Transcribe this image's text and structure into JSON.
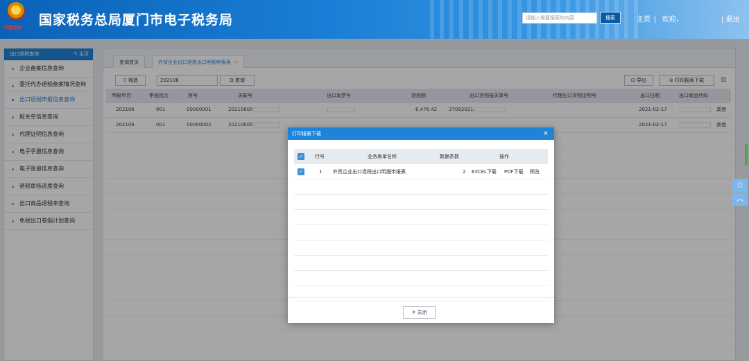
{
  "header": {
    "site_title": "国家税务总局厦门市电子税务局",
    "logo_text": "中国税务",
    "search_placeholder": "请输入需要搜索的内容",
    "search_button": "搜索",
    "nav_home": "主页",
    "nav_sep": "|",
    "nav_welcome": "欢迎，",
    "logout": "| 退出"
  },
  "sidebar": {
    "title": "出口退税查询",
    "home": "↰ 主页",
    "items": [
      {
        "label": "企业备案信息查询"
      },
      {
        "label": "委托代办退税备案情况查询"
      },
      {
        "label": "出口退税申报信息查询"
      },
      {
        "label": "报关单信息查询"
      },
      {
        "label": "代理证明信息查询"
      },
      {
        "label": "电子手册信息查询"
      },
      {
        "label": "电子账册信息查询"
      },
      {
        "label": "退税审核进度查询"
      },
      {
        "label": "出口商品退税率查询"
      },
      {
        "label": "免税出口卷烟计划查询"
      }
    ]
  },
  "tabs": {
    "home": "查询首页",
    "current": "外贸企业出口退税出口明细申报表",
    "close": "×"
  },
  "toolbar": {
    "filter": "▽ 筛选",
    "year_value": "202106",
    "query": "Q 查询",
    "export": "⊡ 导出",
    "print": "⊜ 打印报表下载",
    "columns_icon": "▥"
  },
  "grid": {
    "headers": [
      "申报年月",
      "申报批次",
      "序号",
      "关联号",
      "出口发票号",
      "退税额",
      "出口货物报关单号",
      "代理出口货物证明号",
      "出口日期",
      "出口商品代码"
    ],
    "rows": [
      {
        "ym": "202106",
        "batch": "001",
        "seq": "00000001",
        "rel": "20210600",
        "tax": "6,476.42",
        "decl": "37092021",
        "date": "2021-02-17",
        "extra": "其他"
      },
      {
        "ym": "202106",
        "batch": "001",
        "seq": "00000002",
        "rel": "20210600",
        "tax": "",
        "decl": "",
        "date": "2021-02-17",
        "extra": "其他"
      }
    ]
  },
  "modal": {
    "title": "打印报表下载",
    "close": "×",
    "headers": {
      "row_no": "行号",
      "name": "业务表单名称",
      "count": "数据条数",
      "ops": "操作"
    },
    "rows": [
      {
        "row_no": "1",
        "name": "外贸企业出口退税出口明细申报表",
        "count": "2",
        "excel": "EXCEL下载",
        "pdf": "PDF下载",
        "preview": "预览"
      }
    ],
    "close_button": "✕ 关闭"
  },
  "float": {
    "star": "☆",
    "up": "︿"
  },
  "colors": {
    "primary": "#1f83d8",
    "header_start": "#0a62b8",
    "header_end": "#8ec2ee"
  }
}
